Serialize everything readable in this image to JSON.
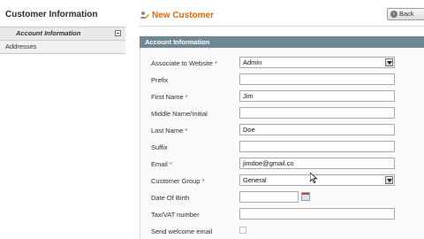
{
  "sidebar": {
    "title": "Customer Information",
    "tabs": [
      {
        "label": "Account Information"
      },
      {
        "label": "Addresses"
      }
    ]
  },
  "header": {
    "title": "New Customer",
    "back_label": "Back"
  },
  "section": {
    "title": "Account Information",
    "fields": [
      {
        "label": "Associate to Website",
        "required": "*",
        "value": "Admin",
        "type": "select"
      },
      {
        "label": "Prefix",
        "value": ""
      },
      {
        "label": "First Name",
        "required": "*",
        "value": "Jim"
      },
      {
        "label": "Middle Name/Initial",
        "value": ""
      },
      {
        "label": "Last Name",
        "required": "*",
        "value": "Doe"
      },
      {
        "label": "Suffix",
        "value": ""
      },
      {
        "label": "Email",
        "required": "*",
        "value": "jimdoe@gmail.co"
      },
      {
        "label": "Customer Group",
        "required": "*",
        "value": "General",
        "type": "select"
      },
      {
        "label": "Date Of Birth",
        "value": "",
        "type": "date"
      },
      {
        "label": "Tax/VAT number",
        "value": ""
      },
      {
        "label": "Send welcome email",
        "type": "checkbox",
        "checked": false
      }
    ]
  },
  "icons": {
    "header": "customer-edit-icon",
    "back": "back-arrow-icon",
    "calendar": "calendar-icon",
    "tab_state": "collapse-icon"
  },
  "colors": {
    "accent": "#e26703",
    "section_header": "#6f8992",
    "required": "#eb340a"
  }
}
